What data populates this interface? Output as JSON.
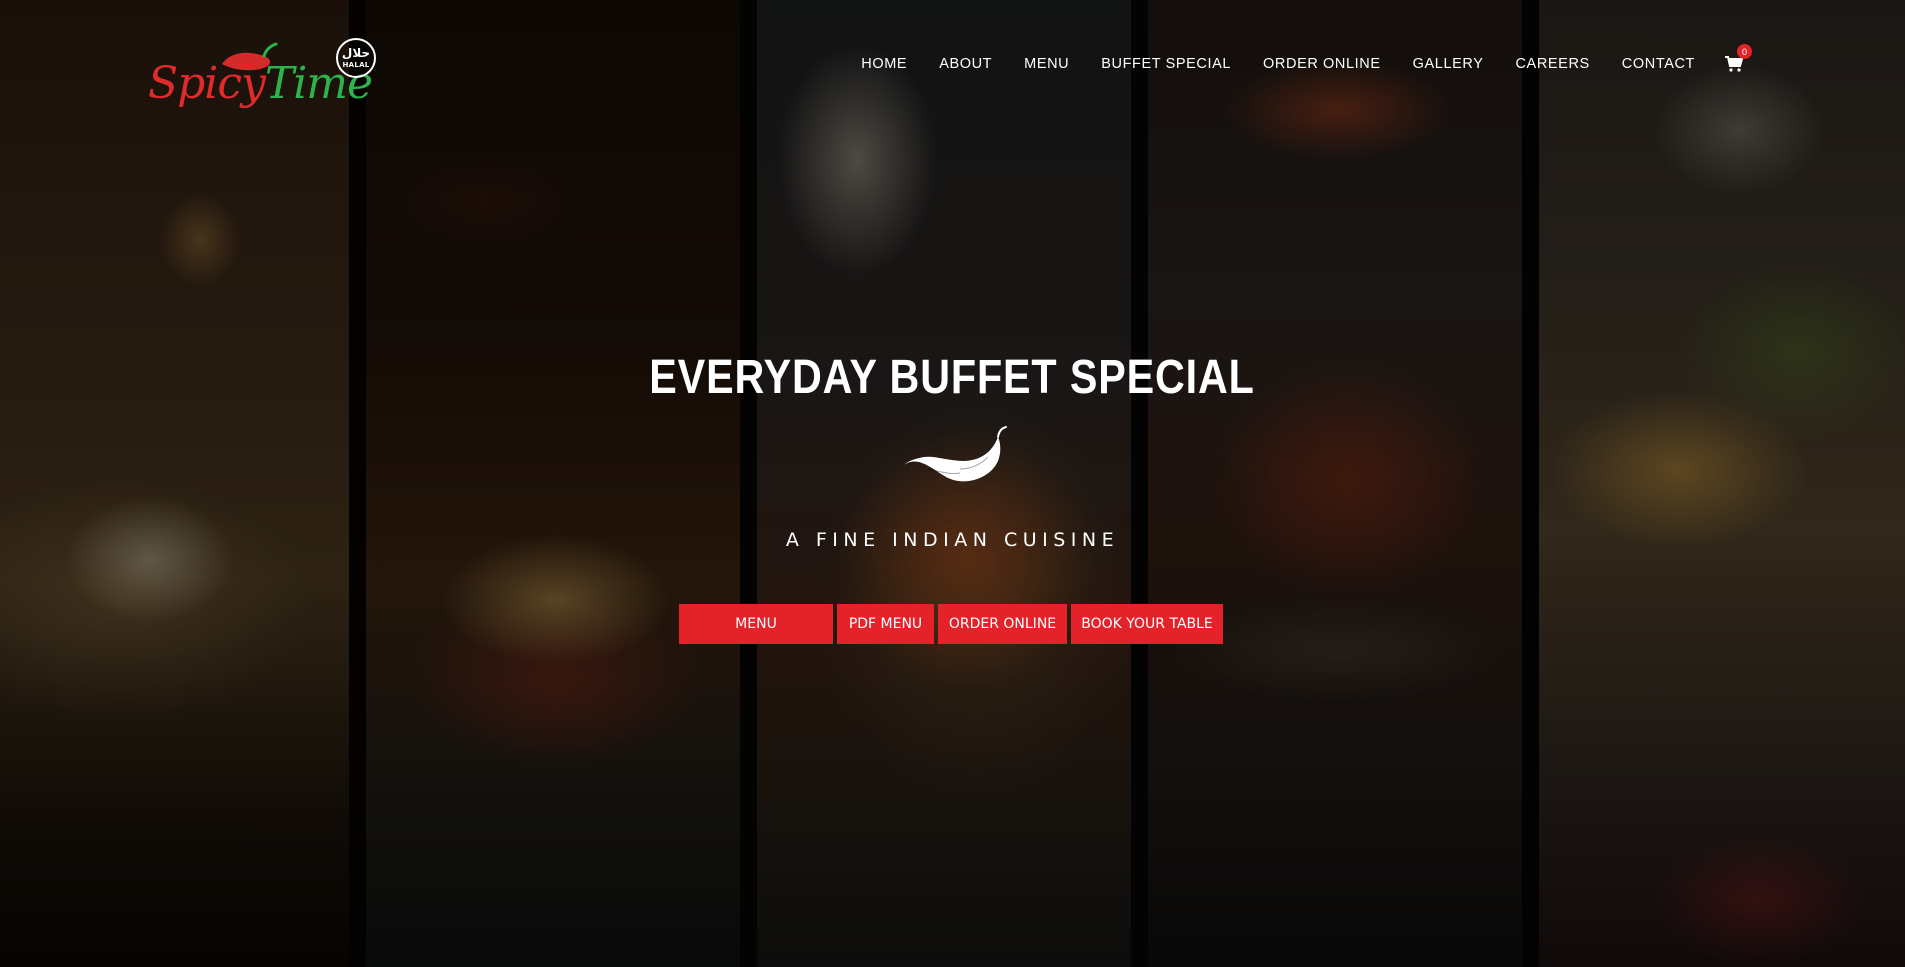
{
  "brand": {
    "logo_part1": "Spicy",
    "logo_part2": "Time",
    "halal_arabic": "حلال",
    "halal_label": "HALAL"
  },
  "nav": {
    "items": [
      "HOME",
      "ABOUT",
      "MENU",
      "BUFFET SPECIAL",
      "ORDER ONLINE",
      "GALLERY",
      "CAREERS",
      "CONTACT"
    ],
    "cart_count": "0"
  },
  "hero": {
    "title": "EVERYDAY BUFFET SPECIAL",
    "subtitle": "A FINE INDIAN CUISINE"
  },
  "buttons": {
    "menu": "MENU",
    "pdf_menu": "PDF MENU",
    "order_online": "ORDER ONLINE",
    "book_table": "BOOK YOUR TABLE"
  },
  "colors": {
    "accent": "#e3222a",
    "logo_red": "#e02b2b",
    "logo_green": "#2db34a"
  }
}
